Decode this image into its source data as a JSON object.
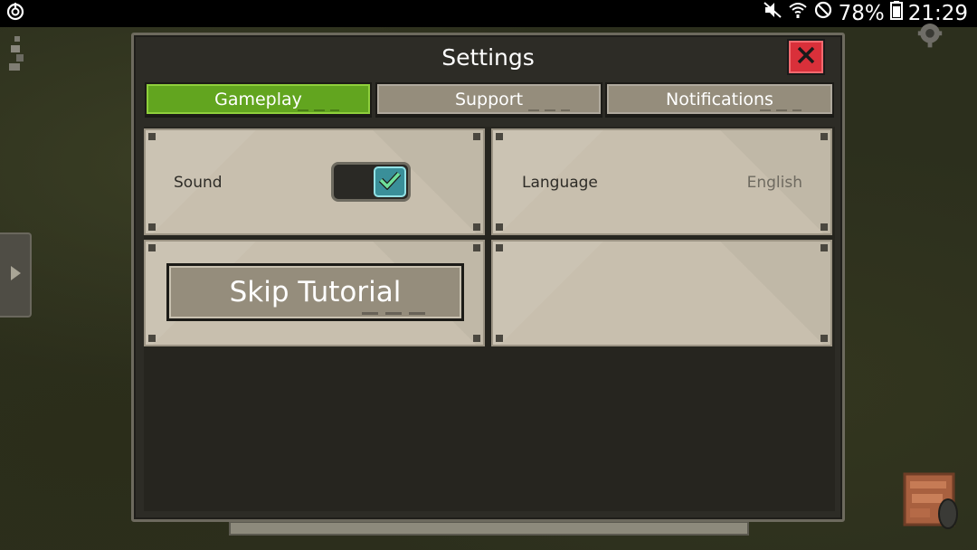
{
  "status_bar": {
    "battery": "78%",
    "time": "21:29",
    "icons": [
      "sync-icon",
      "mute-icon",
      "wifi-icon",
      "blocked-icon",
      "battery-icon"
    ]
  },
  "dialog": {
    "title": "Settings",
    "close_icon": "close-icon"
  },
  "tabs": [
    {
      "label": "Gameplay",
      "active": true
    },
    {
      "label": "Support",
      "active": false
    },
    {
      "label": "Notifications",
      "active": false
    }
  ],
  "settings": {
    "sound_label": "Sound",
    "sound_enabled": true,
    "language_label": "Language",
    "language_value": "English",
    "skip_tutorial_label": "Skip Tutorial"
  },
  "colors": {
    "active_tab": "#62a51f",
    "inactive_tab": "#958d7c",
    "close_button": "#d9303a",
    "toggle_on": "#3a8f99",
    "panel": "#c8bfae"
  }
}
